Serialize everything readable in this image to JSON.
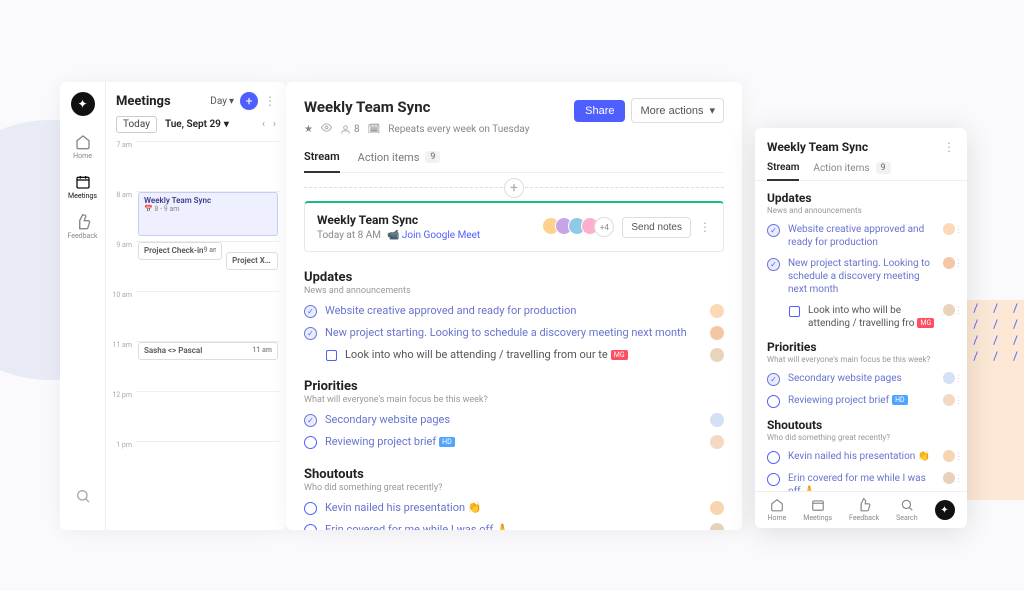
{
  "leftNav": {
    "home": "Home",
    "meetings": "Meetings",
    "feedback": "Feedback"
  },
  "calendar": {
    "title": "Meetings",
    "viewMode": "Day",
    "today": "Today",
    "date": "Tue, Sept 29",
    "times": [
      "7 am",
      "8 am",
      "9 am",
      "10 am",
      "11 am",
      "12 pm",
      "1 pm"
    ],
    "events": {
      "weekly": {
        "title": "Weekly Team Sync",
        "time": "8 - 9 am"
      },
      "checkin": {
        "title": "Project Check-in",
        "time": "9 am"
      },
      "kick": {
        "title": "Project X Kick..."
      },
      "sasha": {
        "title": "Sasha <> Pascal",
        "time": "11 am"
      }
    }
  },
  "center": {
    "title": "Weekly Team Sync",
    "attendees": "8",
    "repeat": "Repeats every week on Tuesday",
    "share": "Share",
    "more": "More actions",
    "tabs": {
      "stream": "Stream",
      "actions": "Action items",
      "count": "9"
    },
    "session": {
      "title": "Weekly Team Sync",
      "sub": "Today at 8 AM",
      "join": "Join Google Meet",
      "avMore": "+4",
      "send": "Send notes"
    },
    "sections": {
      "updates": {
        "title": "Updates",
        "desc": "News and announcements",
        "i1": "Website creative approved and ready for production",
        "i2": "New project starting. Looking to schedule a discovery meeting next month",
        "i3": "Look into who will be attending / travelling from our te",
        "tag3": "MG"
      },
      "priorities": {
        "title": "Priorities",
        "desc": "What will everyone's main focus be this week?",
        "i1": "Secondary website pages",
        "i2": "Reviewing project brief",
        "tag2": "HD"
      },
      "shoutouts": {
        "title": "Shoutouts",
        "desc": "Who did something great recently?",
        "i1": "Kevin nailed his presentation 👏",
        "i2": "Erin covered for me while I was off 🙏"
      }
    }
  },
  "right": {
    "title": "Weekly Team Sync",
    "tabs": {
      "stream": "Stream",
      "actions": "Action items",
      "count": "9"
    },
    "sections": {
      "updates": {
        "title": "Updates",
        "desc": "News and announcements",
        "i1": "Website creative approved and ready for production",
        "i2": "New project starting. Looking to schedule a discovery meeting next month",
        "i3": "Look into who will be attending / travelling fro",
        "tag3": "MG"
      },
      "priorities": {
        "title": "Priorities",
        "desc": "What will everyone's main focus be this week?",
        "i1": "Secondary website pages",
        "i2": "Reviewing project brief",
        "tag2": "HD"
      },
      "shoutouts": {
        "title": "Shoutouts",
        "desc": "Who did something great recently?",
        "i1": "Kevin nailed his presentation 👏",
        "i2": "Erin covered for me while I was off 🙏"
      }
    },
    "nav": {
      "home": "Home",
      "meetings": "Meetings",
      "feedback": "Feedback",
      "search": "Search"
    }
  }
}
